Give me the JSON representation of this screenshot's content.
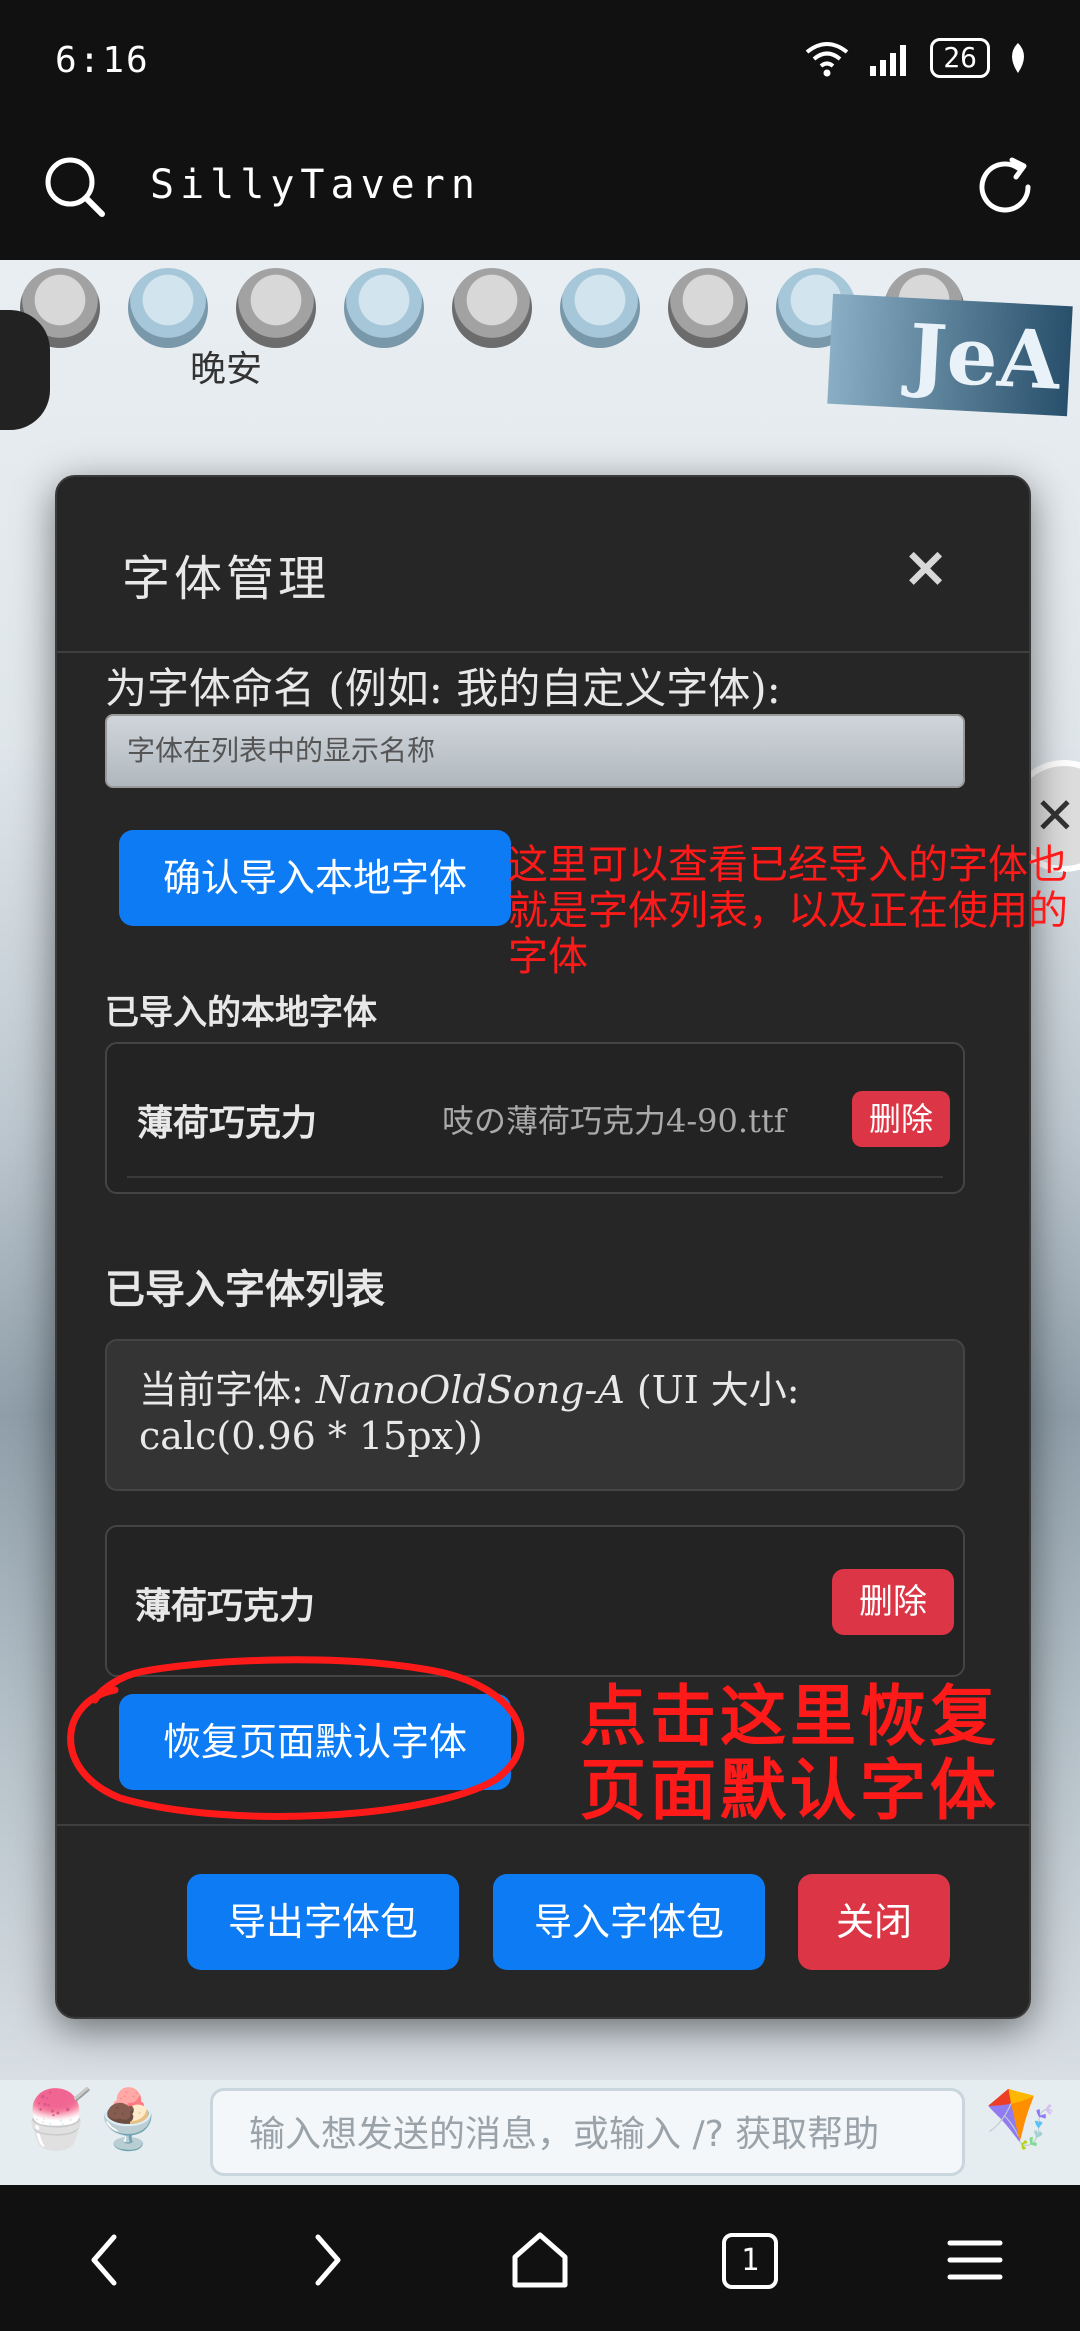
{
  "status_bar": {
    "time": "6:16",
    "battery": "26"
  },
  "browser": {
    "title": "SillyTavern"
  },
  "background": {
    "partial_text": "晚安",
    "sticker_text": "JeA"
  },
  "modal": {
    "title": "字体管理",
    "close_symbol": "×",
    "name_label": "为字体命名 (例如: 我的自定义字体):",
    "name_placeholder": "字体在列表中的显示名称",
    "confirm_button": "确认导入本地字体",
    "local_section_title": "已导入的本地字体",
    "local_fonts": [
      {
        "name": "薄荷巧克力",
        "file": "吱の薄荷巧克力4-90.ttf",
        "delete_label": "删除"
      }
    ],
    "list_section_title": "已导入字体列表",
    "current_font": {
      "prefix": "当前字体: ",
      "font_name": "NanoOldSong-A",
      "suffix": " (UI 大小: calc(0.96 * 15px))"
    },
    "font_list": [
      {
        "name": "薄荷巧克力",
        "delete_label": "删除"
      }
    ],
    "restore_button": "恢复页面默认字体",
    "export_button": "导出字体包",
    "import_button": "导入字体包",
    "close_button": "关闭"
  },
  "annotations": {
    "note_list": "这里可以查看已经导入的字体也就是字体列表，以及正在使用的字体",
    "note_restore_line1": "点击这里恢复",
    "note_restore_line2": "页面默认字体",
    "color": "#ff1a1a"
  },
  "chat": {
    "placeholder": "输入想发送的消息，或输入 /? 获取帮助"
  },
  "navigation": {
    "tab_count": "1"
  },
  "colors": {
    "primary": "#0d7bf4",
    "danger": "#dc3545",
    "modal_bg": "#262626"
  }
}
